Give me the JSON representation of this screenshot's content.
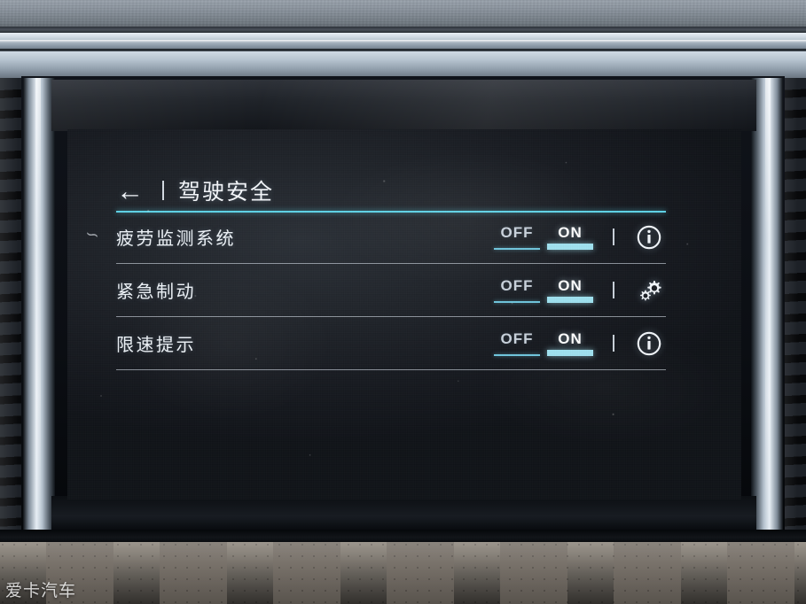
{
  "screen": {
    "header": {
      "back_icon": "back-arrow-icon",
      "divider": "|",
      "title": "驾驶安全"
    },
    "rows": [
      {
        "label": "疲劳监测系统",
        "off_label": "OFF",
        "on_label": "ON",
        "selected": "ON",
        "divider": "|",
        "action_icon": "info-icon"
      },
      {
        "label": "紧急制动",
        "off_label": "OFF",
        "on_label": "ON",
        "selected": "ON",
        "divider": "|",
        "action_icon": "settings-gears-icon"
      },
      {
        "label": "限速提示",
        "off_label": "OFF",
        "on_label": "ON",
        "selected": "ON",
        "divider": "|",
        "action_icon": "info-icon"
      }
    ]
  },
  "watermark": "爱卡汽车",
  "colors": {
    "accent_cyan": "#5fd4e8",
    "toggle_on_bar": "#9fe2f0",
    "toggle_off_bar": "#6fc6dd",
    "text_primary": "#f4f7fb",
    "text_dim": "#c9d2dc",
    "screen_bg": "#20242a"
  }
}
